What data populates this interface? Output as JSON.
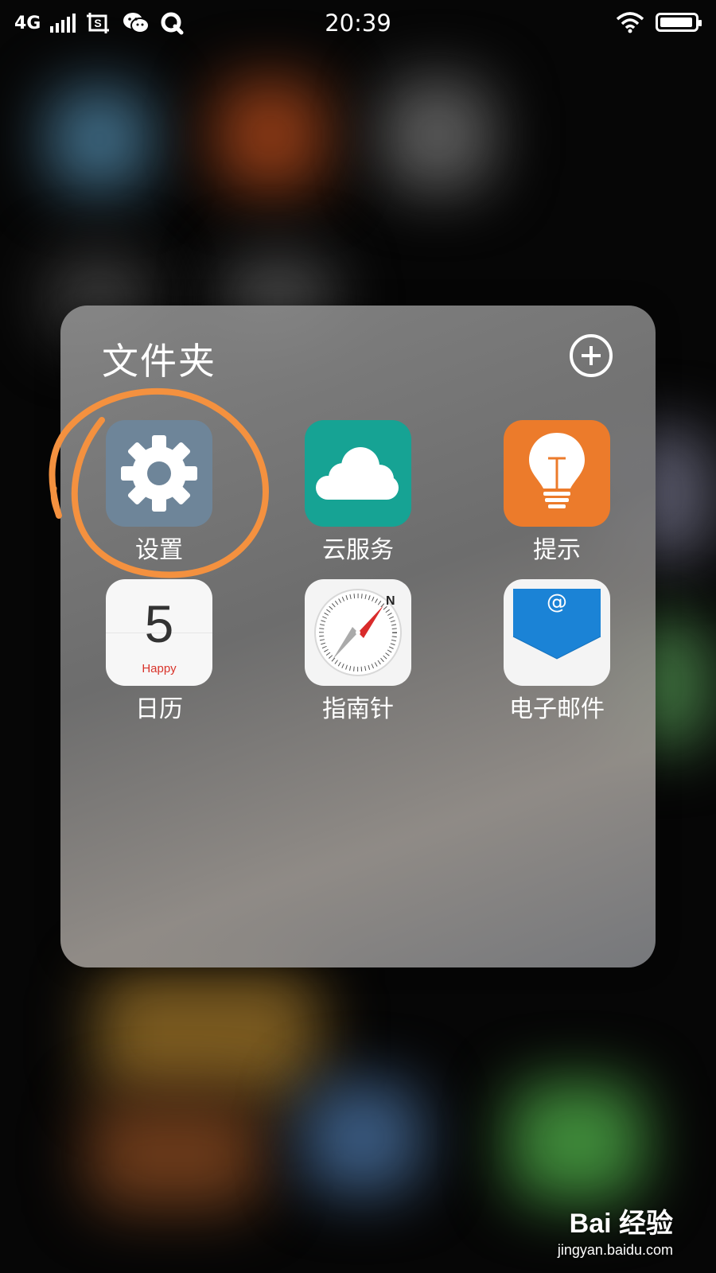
{
  "status_bar": {
    "network": "4G",
    "time": "20:39",
    "battery_level": 0.95
  },
  "folder": {
    "title": "文件夹",
    "apps": [
      {
        "label": "设置",
        "icon": "gear-icon"
      },
      {
        "label": "云服务",
        "icon": "cloud-icon"
      },
      {
        "label": "提示",
        "icon": "lightbulb-icon"
      },
      {
        "label": "日历",
        "icon": "calendar-icon",
        "day": "5",
        "note": "Happy"
      },
      {
        "label": "指南针",
        "icon": "compass-icon",
        "north": "N"
      },
      {
        "label": "电子邮件",
        "icon": "mail-icon",
        "symbol": "@"
      }
    ]
  },
  "watermark": {
    "brand": "Bai 经验",
    "url": "jingyan.baidu.com"
  },
  "colors": {
    "annotation": "#f4913f",
    "settings": "#6e8599",
    "cloud": "#16a394",
    "tips": "#ec7b2b",
    "mail": "#1b83d6"
  }
}
